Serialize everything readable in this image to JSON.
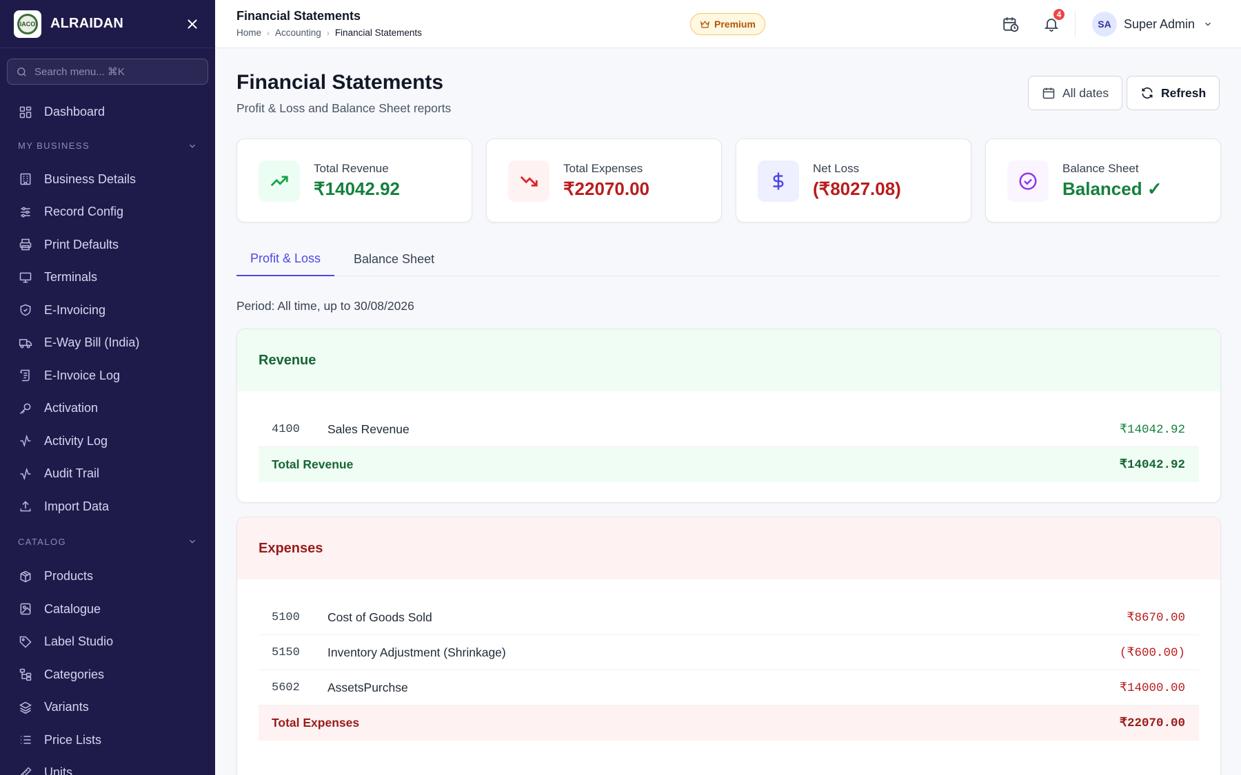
{
  "sidebar": {
    "brand": "ALRAIDAN",
    "logo_text": "IACO",
    "search_placeholder": "Search menu... ⌘K",
    "dashboard": "Dashboard",
    "sections": [
      {
        "label": "MY BUSINESS",
        "items": [
          "Business Details",
          "Record Config",
          "Print Defaults",
          "Terminals",
          "E-Invoicing",
          "E-Way Bill (India)",
          "E-Invoice Log",
          "Activation",
          "Activity Log",
          "Audit Trail",
          "Import Data"
        ]
      },
      {
        "label": "CATALOG",
        "items": [
          "Products",
          "Catalogue",
          "Label Studio",
          "Categories",
          "Variants",
          "Price Lists",
          "Units"
        ]
      }
    ]
  },
  "topbar": {
    "title": "Financial Statements",
    "breadcrumb": [
      "Home",
      "Accounting",
      "Financial Statements"
    ],
    "premium": "Premium",
    "notifications": "4",
    "user_initials": "SA",
    "user_name": "Super Admin"
  },
  "page": {
    "title": "Financial Statements",
    "subtitle": "Profit & Loss and Balance Sheet reports",
    "date_button": "All dates",
    "refresh_button": "Refresh"
  },
  "cards": [
    {
      "label": "Total Revenue",
      "value": "₹14042.92",
      "color": "#15803d",
      "bg": "#ecfdf3"
    },
    {
      "label": "Total Expenses",
      "value": "₹22070.00",
      "color": "#b91c1c",
      "bg": "#fef2f2"
    },
    {
      "label": "Net Loss",
      "value": "(₹8027.08)",
      "color": "#b91c1c",
      "bg": "#eef0ff"
    },
    {
      "label": "Balance Sheet",
      "value": "Balanced ✓",
      "color": "#15803d",
      "bg": "#faf5ff"
    }
  ],
  "tabs": [
    "Profit & Loss",
    "Balance Sheet"
  ],
  "period": "Period: All time, up to 30/08/2026",
  "revenue": {
    "title": "Revenue",
    "rows": [
      {
        "code": "4100",
        "name": "Sales Revenue",
        "amount": "₹14042.92"
      }
    ],
    "total_label": "Total Revenue",
    "total_amount": "₹14042.92"
  },
  "expenses": {
    "title": "Expenses",
    "rows": [
      {
        "code": "5100",
        "name": "Cost of Goods Sold",
        "amount": "₹8670.00"
      },
      {
        "code": "5150",
        "name": "Inventory Adjustment (Shrinkage)",
        "amount": "(₹600.00)"
      },
      {
        "code": "5602",
        "name": "AssetsPurchse",
        "amount": "₹14000.00"
      }
    ],
    "total_label": "Total Expenses",
    "total_amount": "₹22070.00"
  },
  "colors": {
    "sidebar_bg": "#1e1b4b",
    "accent": "#4f46e5",
    "positive": "#15803d",
    "negative": "#b91c1c"
  }
}
